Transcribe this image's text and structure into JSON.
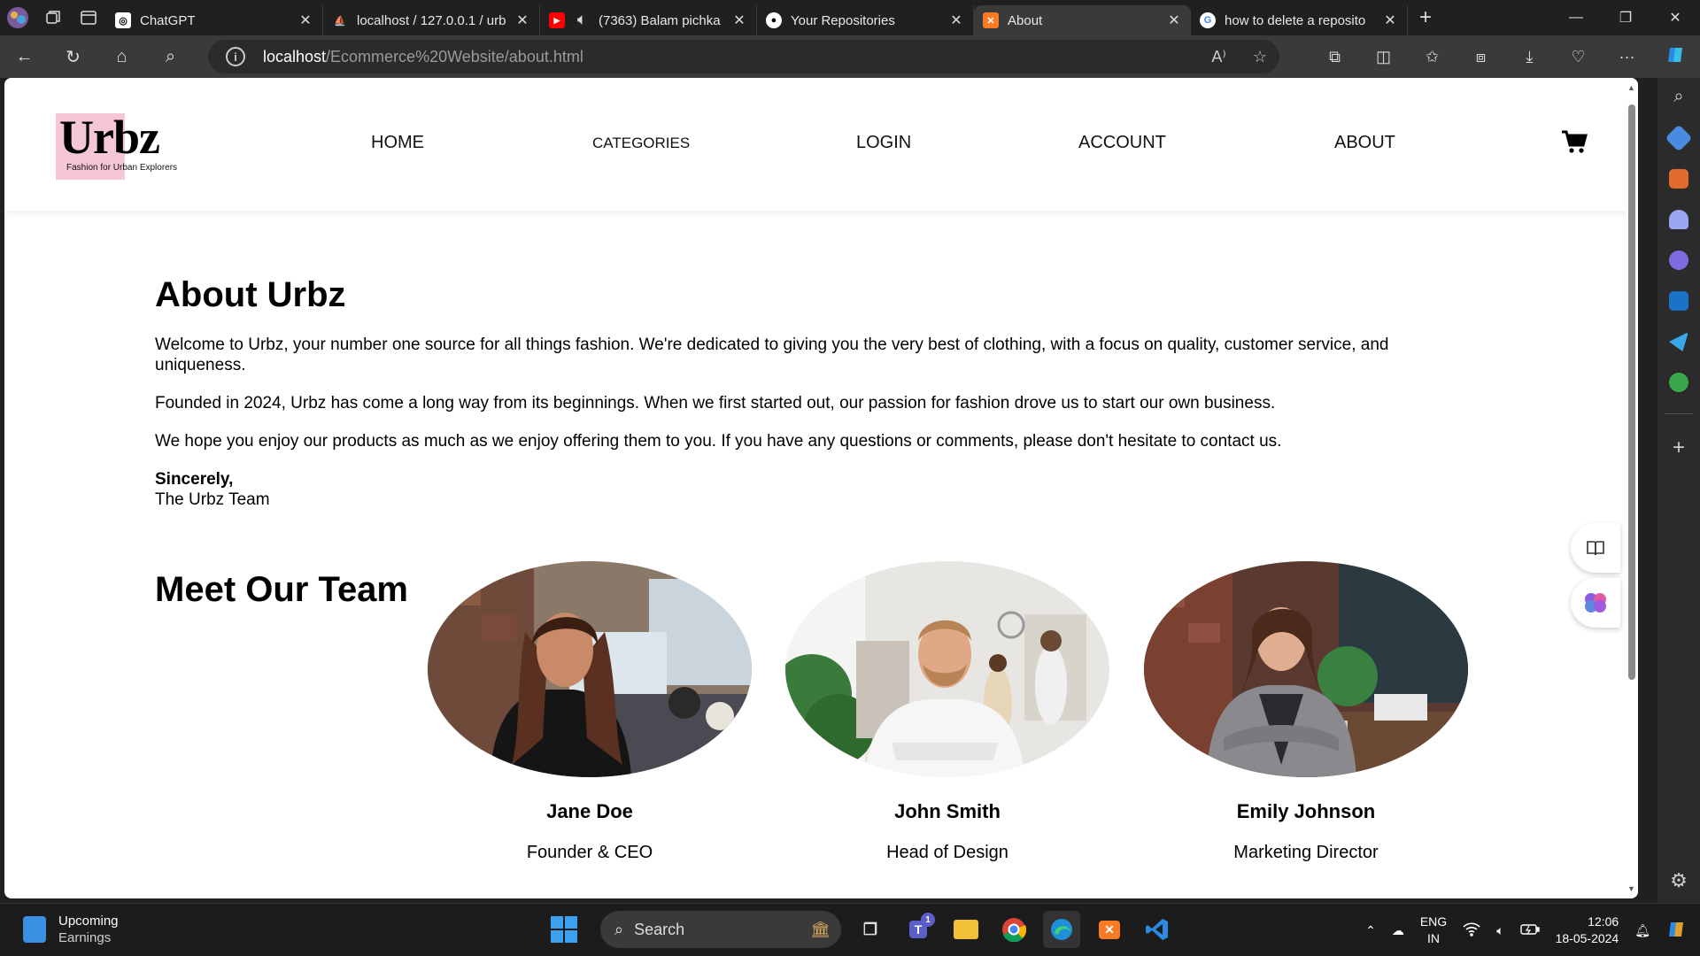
{
  "browser": {
    "tabs": [
      {
        "title": "ChatGPT",
        "fav": "chatgpt-icon",
        "color": "#ffffff"
      },
      {
        "title": "localhost / 127.0.0.1 / urb",
        "fav": "phpmyadmin-icon",
        "color": "#f0a030"
      },
      {
        "title": "(7363) Balam pichka",
        "fav": "youtube-icon",
        "color": "#ff0000"
      },
      {
        "title": "Your Repositories",
        "fav": "github-icon",
        "color": "#ffffff"
      },
      {
        "title": "About",
        "fav": "xampp-icon",
        "color": "#fb7a24",
        "active": true
      },
      {
        "title": "how to delete a reposito",
        "fav": "google-icon",
        "color": "#4285f4"
      }
    ],
    "url_host": "localhost",
    "url_path": "/Ecommerce%20Website/about.html"
  },
  "site": {
    "logo_word": "Urbz",
    "logo_tagline": "Fashion for Urban Explorers",
    "nav": [
      "HOME",
      "CATEGORIES",
      "LOGIN",
      "ACCOUNT",
      "ABOUT"
    ],
    "accent_color": "#f5c6d3"
  },
  "about": {
    "title": "About Urbz",
    "paragraphs": [
      "Welcome to Urbz, your number one source for all things fashion. We're dedicated to giving you the very best of clothing, with a focus on quality, customer service, and uniqueness.",
      "Founded in 2024, Urbz has come a long way from its beginnings. When we first started out, our passion for fashion drove us to start our own business.",
      "We hope you enjoy our products as much as we enjoy offering them to you. If you have any questions or comments, please don't hesitate to contact us."
    ],
    "signoff": "Sincerely,",
    "signature": "The Urbz Team"
  },
  "team": {
    "title": "Meet Our Team",
    "members": [
      {
        "name": "Jane Doe",
        "role": "Founder & CEO"
      },
      {
        "name": "John Smith",
        "role": "Head of Design"
      },
      {
        "name": "Emily Johnson",
        "role": "Marketing Director"
      }
    ]
  },
  "taskbar": {
    "weather_title": "Upcoming",
    "weather_sub": "Earnings",
    "search_label": "Search",
    "teams_badge": "1",
    "lang_top": "ENG",
    "lang_bottom": "IN",
    "time": "12:06",
    "date": "18-05-2024"
  }
}
